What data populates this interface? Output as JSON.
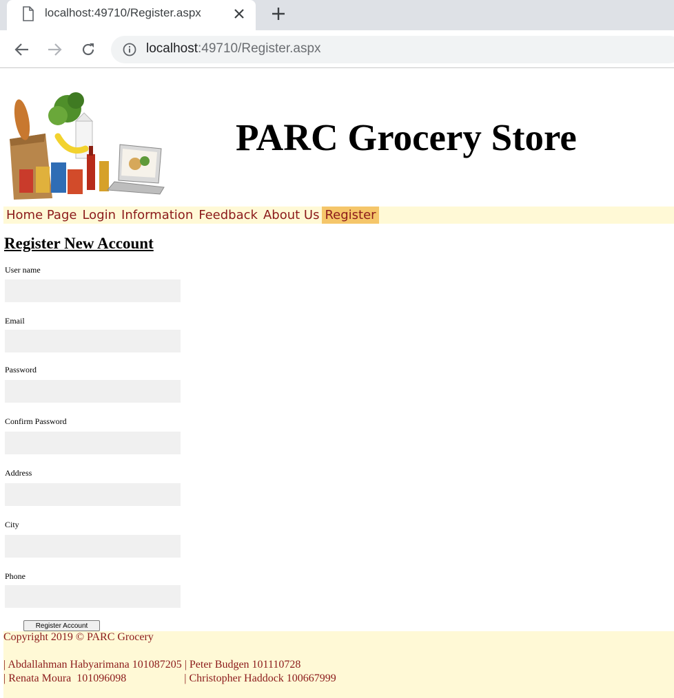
{
  "browser": {
    "tab_title": "localhost:49710/Register.aspx",
    "url_host": "localhost",
    "url_rest": ":49710/Register.aspx"
  },
  "header": {
    "site_title": "PARC Grocery Store"
  },
  "nav": {
    "items": [
      {
        "label": "Home Page"
      },
      {
        "label": "Login"
      },
      {
        "label": "Information"
      },
      {
        "label": "Feedback"
      },
      {
        "label": "About Us"
      },
      {
        "label": "Register",
        "active": true
      }
    ]
  },
  "form": {
    "title": "Register New Account",
    "fields": [
      {
        "label": "User name",
        "value": ""
      },
      {
        "label": "Email",
        "value": ""
      },
      {
        "label": "Password",
        "value": ""
      },
      {
        "label": "Confirm Password",
        "value": ""
      },
      {
        "label": "Address",
        "value": ""
      },
      {
        "label": "City",
        "value": ""
      },
      {
        "label": "Phone",
        "value": ""
      }
    ],
    "submit_label": "Register Account"
  },
  "footer": {
    "copyright": "Copyright 2019 © PARC Grocery",
    "members_line1": "| Abdallahman Habyarimana 101087205 | Peter Budgen 101110728",
    "members_line2": "| Renata Moura  101096098                     | Christopher Haddock 100667999"
  },
  "colors": {
    "nav_background": "#fff9d6",
    "nav_active": "#f5c66a",
    "nav_text": "#8b1a1a",
    "input_background": "#f0f0f0"
  }
}
